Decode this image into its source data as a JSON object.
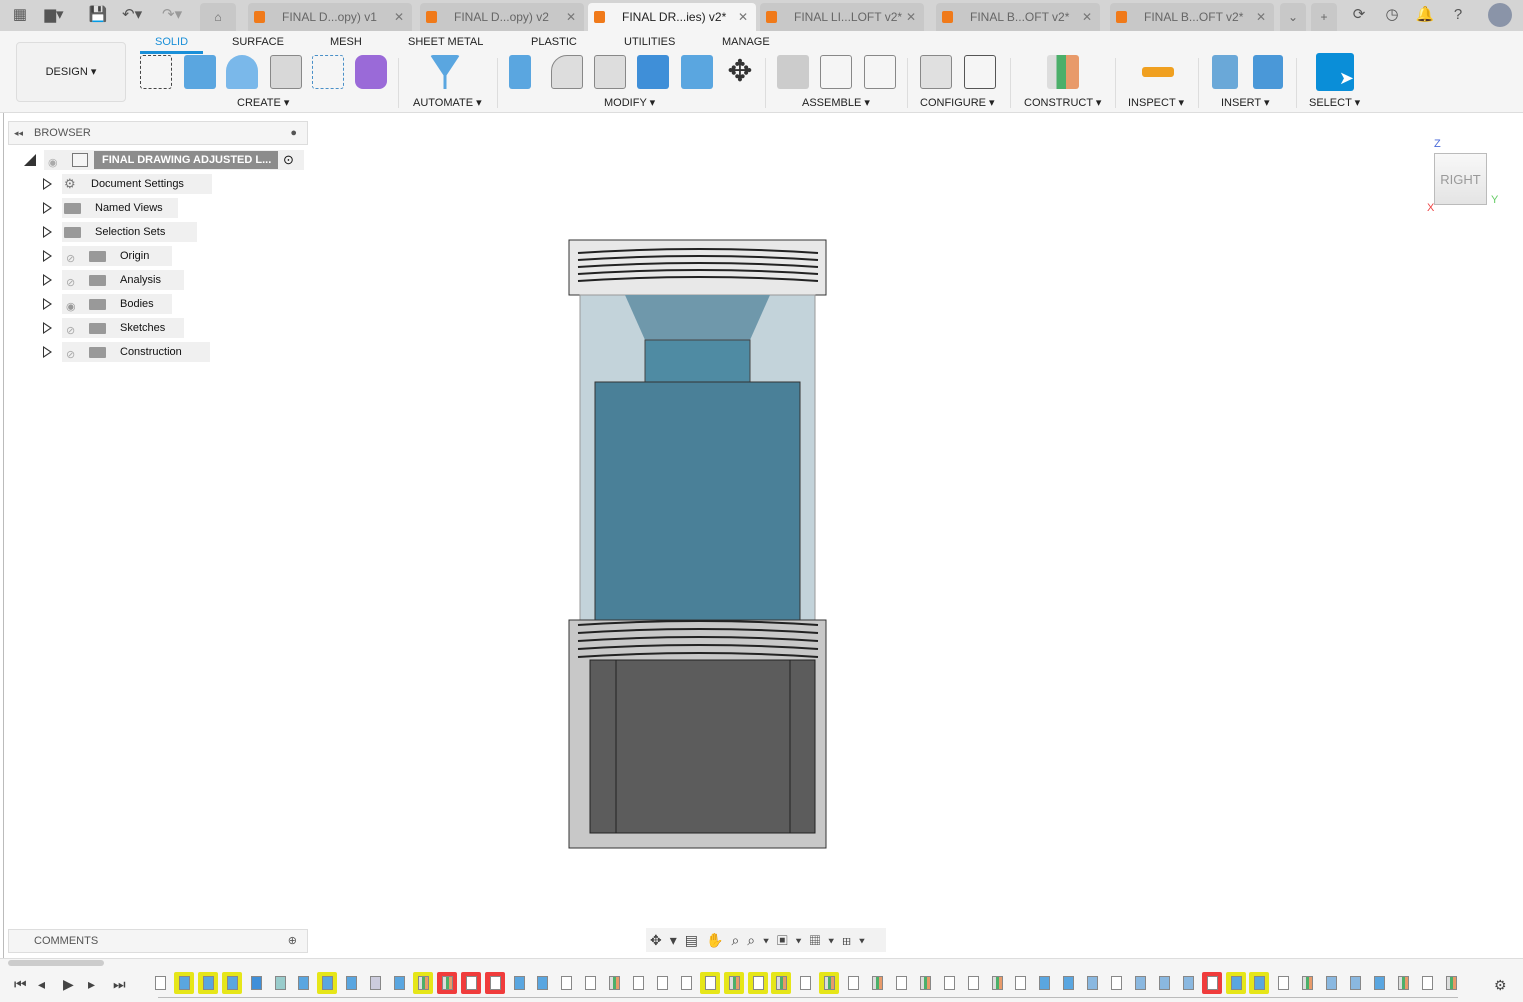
{
  "tabs": [
    {
      "label": "FINAL D...opy) v1",
      "active": false
    },
    {
      "label": "FINAL D...opy) v2",
      "active": false
    },
    {
      "label": "FINAL DR...ies) v2*",
      "active": true
    },
    {
      "label": "FINAL LI...LOFT v2*",
      "active": false
    },
    {
      "label": "FINAL B...OFT v2*",
      "active": false
    },
    {
      "label": "FINAL B...OFT v2*",
      "active": false
    }
  ],
  "workspace": "DESIGN",
  "ribbon_tabs": [
    "SOLID",
    "SURFACE",
    "MESH",
    "SHEET METAL",
    "PLASTIC",
    "UTILITIES",
    "MANAGE"
  ],
  "groups": [
    "CREATE",
    "AUTOMATE",
    "MODIFY",
    "ASSEMBLE",
    "CONFIGURE",
    "CONSTRUCT",
    "INSPECT",
    "INSERT",
    "SELECT"
  ],
  "browser": {
    "title": "BROWSER",
    "root": "FINAL DRAWING ADJUSTED L...",
    "items": [
      {
        "label": "Document Settings",
        "icon": "gear-icon",
        "eye": null
      },
      {
        "label": "Named Views",
        "icon": "folder-icon",
        "eye": null
      },
      {
        "label": "Selection Sets",
        "icon": "folder-icon",
        "eye": null
      },
      {
        "label": "Origin",
        "icon": "folder-icon",
        "eye": "hidden"
      },
      {
        "label": "Analysis",
        "icon": "folder-icon",
        "eye": "hidden"
      },
      {
        "label": "Bodies",
        "icon": "folder-icon",
        "eye": "visible"
      },
      {
        "label": "Sketches",
        "icon": "folder-icon",
        "eye": "hidden"
      },
      {
        "label": "Construction",
        "icon": "folder-icon",
        "eye": "hidden"
      }
    ]
  },
  "comments": "COMMENTS",
  "viewcube": {
    "face": "RIGHT",
    "axis_z": "Z",
    "axis_y": "Y",
    "axis_x": "X"
  },
  "colors": {
    "accent": "#1a8fd8",
    "highlight_yellow": "#e6e619",
    "highlight_red": "#f03c3c",
    "tab_icon": "#f07a1a"
  },
  "timeline": [
    "sketch",
    "extrude:y",
    "extrude:y",
    "extrude:y",
    "combine",
    "coil",
    "extrude",
    "extrude:y",
    "extrude",
    "delete",
    "extrude",
    "plane:y",
    "plane:r",
    "move:r",
    "move:r",
    "align",
    "align",
    "sketch",
    "sketch",
    "plane",
    "sketch",
    "sketch",
    "sketch",
    "sketch:y",
    "plane:y",
    "sketch:y",
    "plane:y",
    "sketch",
    "plane:y",
    "sketch",
    "plane",
    "sketch",
    "plane",
    "sketch",
    "sketch",
    "plane",
    "sketch",
    "extrude",
    "extrude",
    "shell",
    "sketch",
    "shell",
    "shell",
    "shell",
    "move:r",
    "extrude:y",
    "extrude:y",
    "move",
    "plane",
    "shell",
    "shell",
    "extrude",
    "plane",
    "sketch",
    "plane"
  ]
}
